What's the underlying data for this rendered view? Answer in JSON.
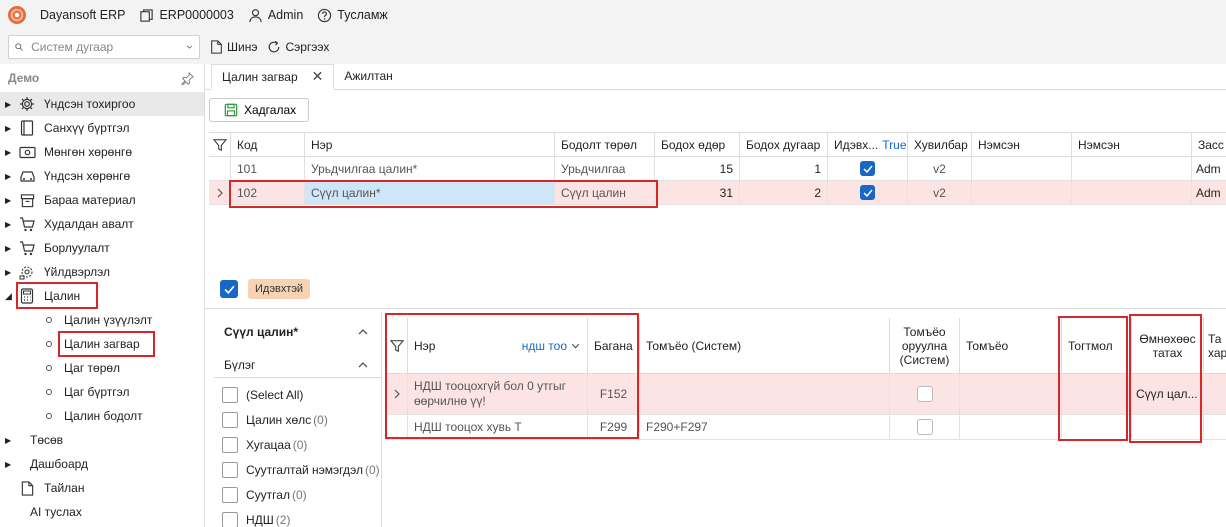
{
  "topbar": {
    "app_name": "Dayansoft ERP",
    "code": "ERP0000003",
    "user": "Admin",
    "help": "Тусламж"
  },
  "toolbar": {
    "search_placeholder": "Систем дугаар",
    "new_label": "Шинэ",
    "refresh_label": "Сэргээх"
  },
  "sidebar": {
    "title": "Демо",
    "items": [
      {
        "label": "Үндсэн тохиргоо",
        "icon": "gear-icon"
      },
      {
        "label": "Санхүү бүртгэл",
        "icon": "ledger-icon"
      },
      {
        "label": "Мөнгөн хөрөнгө",
        "icon": "money-icon"
      },
      {
        "label": "Үндсэн хөрөнгө",
        "icon": "car-icon"
      },
      {
        "label": "Бараа материал",
        "icon": "box-icon"
      },
      {
        "label": "Худалдан авалт",
        "icon": "cart-icon"
      },
      {
        "label": "Борлуулалт",
        "icon": "cart-icon"
      },
      {
        "label": "Үйлдвэрлэл",
        "icon": "factory-icon"
      },
      {
        "label": "Цалин",
        "icon": "calculator-icon"
      }
    ],
    "sub_items": [
      "Цалин үзүүлэлт",
      "Цалин загвар",
      "Цаг төрөл",
      "Цаг бүртгэл",
      "Цалин бодолт"
    ],
    "after_items": [
      {
        "label": "Төсөв",
        "icon": "none"
      },
      {
        "label": "Дашбоард",
        "icon": "dashboard-icon"
      },
      {
        "label": "Тайлан",
        "icon": "report-icon"
      },
      {
        "label": "AI туслах",
        "icon": "ai-icon"
      }
    ]
  },
  "tabs": [
    {
      "label": "Цалин загвар"
    },
    {
      "label": "Ажилтан"
    }
  ],
  "save_label": "Хадгалах",
  "grid1": {
    "headers": [
      "Код",
      "Нэр",
      "Бодолт төрөл",
      "Бодох өдөр",
      "Бодох дугаар",
      "Идэвх...",
      "Хувилбар",
      "Нэмсэн",
      "Нэмсэн",
      "Засс"
    ],
    "active_filter": "True",
    "rows": [
      {
        "code": "101",
        "name": "Урьдчилгаа цалин*",
        "type": "Урьдчилгаа",
        "day": "15",
        "num": "1",
        "version": "v2",
        "added_by": "Adm"
      },
      {
        "code": "102",
        "name": "Сүүл цалин*",
        "type": "Сүүл цалин",
        "day": "31",
        "num": "2",
        "version": "v2",
        "added_by": "Adm"
      }
    ]
  },
  "filter_tag": "Идэвхтэй",
  "filter_panel": {
    "title": "Сүүл цалин*",
    "group_label": "Бүлэг",
    "items": [
      {
        "label": "(Select All)",
        "count": ""
      },
      {
        "label": "Цалин хөлс",
        "count": "(0)"
      },
      {
        "label": "Хугацаа",
        "count": "(0)"
      },
      {
        "label": "Суутгалтай нэмэгдэл",
        "count": "(0)"
      },
      {
        "label": "Суутгал",
        "count": "(0)"
      },
      {
        "label": "НДШ",
        "count": "(2)"
      }
    ]
  },
  "grid2": {
    "headers": {
      "name": "Нэр",
      "filter": "ндш тоо",
      "column": "Багана",
      "formula_sys": "Томъёо (Систем)",
      "formula_insert_sys": "Томъёо оруулна (Систем)",
      "formula": "Томъёо",
      "constant": "Тогтмол",
      "prev_pull": "Өмнөхөөс татах",
      "next": "Та хар"
    },
    "rows": [
      {
        "name": "НДШ тооцохгүй бол 0 утгыг өөрчилнө үү!",
        "column": "F152",
        "formula_sys": "",
        "prev_pull": "Сүүл цал..."
      },
      {
        "name": "НДШ тооцох хувь Т",
        "column": "F299",
        "formula_sys": "F290+F297",
        "prev_pull": ""
      }
    ]
  },
  "colors": {
    "accent": "#1767c6",
    "selected_row": "#fde4e4",
    "highlight_cell": "#cfe6f8",
    "annotation_red": "#d62828",
    "tag_bg": "#f7d2b3"
  }
}
